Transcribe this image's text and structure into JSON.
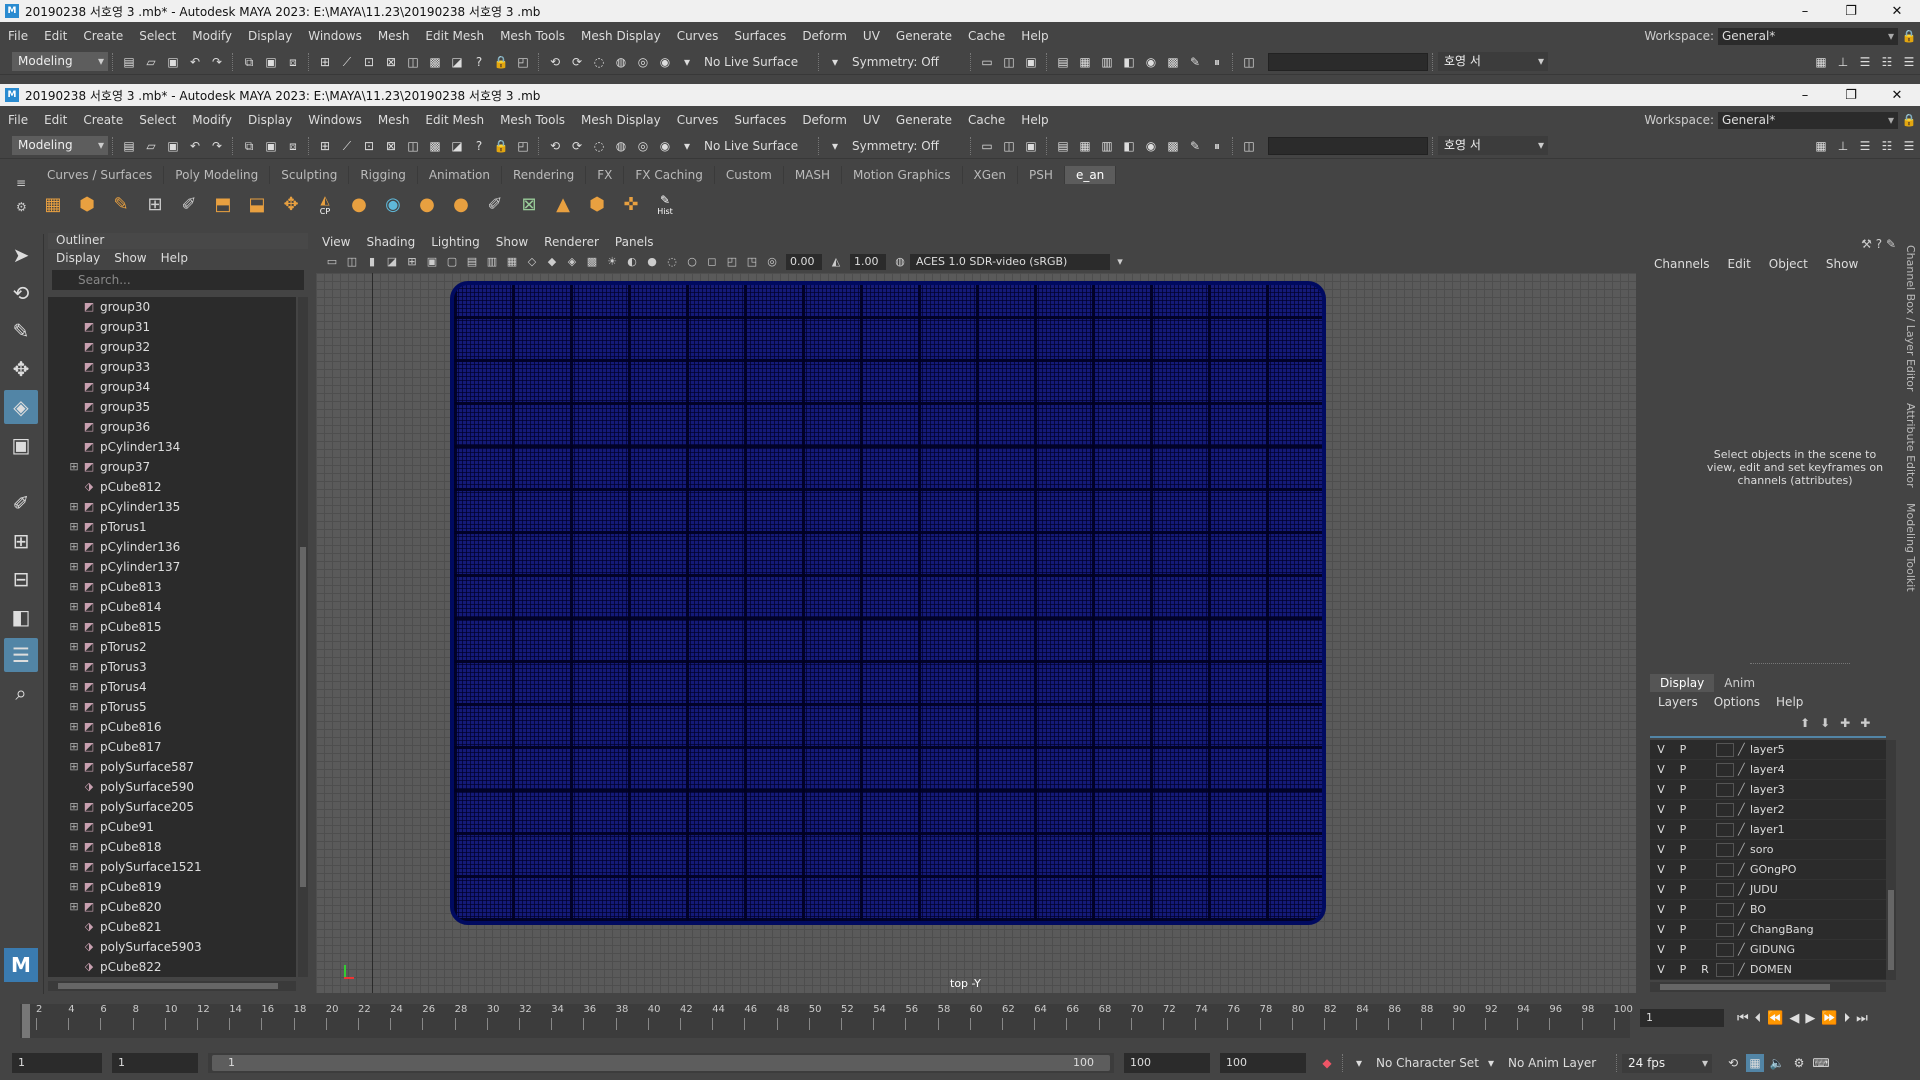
{
  "window": {
    "title_outer": "20190238 서호영 3 .mb* - Autodesk MAYA 2023: E:\\MAYA\\11.23\\20190238 서호영 3 .mb",
    "title_inner": "20190238 서호영 3 .mb* - Autodesk MAYA 2023: E:\\MAYA\\11.23\\20190238 서호영 3 .mb",
    "minimize": "–",
    "restore": "❐",
    "close": "✕"
  },
  "menus": [
    "File",
    "Edit",
    "Create",
    "Select",
    "Modify",
    "Display",
    "Windows",
    "Mesh",
    "Edit Mesh",
    "Mesh Tools",
    "Mesh Display",
    "Curves",
    "Surfaces",
    "Deform",
    "UV",
    "Generate",
    "Cache",
    "Help"
  ],
  "workspace": {
    "label": "Workspace:",
    "value": "General*"
  },
  "status": {
    "mode": "Modeling",
    "live_surface": "No Live Surface",
    "symmetry": "Symmetry: Off",
    "user": "호영 서"
  },
  "shelf_tabs": [
    "Curves / Surfaces",
    "Poly Modeling",
    "Sculpting",
    "Rigging",
    "Animation",
    "Rendering",
    "FX",
    "FX Caching",
    "Custom",
    "MASH",
    "Motion Graphics",
    "XGen",
    "PSH",
    "e_an"
  ],
  "shelf_active": "e_an",
  "shelf_icon_labels": {
    "cp": "CP",
    "hist": "Hist"
  },
  "outliner": {
    "title": "Outliner",
    "menu": [
      "Display",
      "Show",
      "Help"
    ],
    "search_placeholder": "Search...",
    "items": [
      {
        "name": "group30",
        "expand": false,
        "type": "mesh"
      },
      {
        "name": "group31",
        "expand": false,
        "type": "mesh"
      },
      {
        "name": "group32",
        "expand": false,
        "type": "mesh"
      },
      {
        "name": "group33",
        "expand": false,
        "type": "mesh"
      },
      {
        "name": "group34",
        "expand": false,
        "type": "mesh"
      },
      {
        "name": "group35",
        "expand": false,
        "type": "mesh"
      },
      {
        "name": "group36",
        "expand": false,
        "type": "mesh"
      },
      {
        "name": "pCylinder134",
        "expand": false,
        "type": "mesh"
      },
      {
        "name": "group37",
        "expand": true,
        "type": "mesh"
      },
      {
        "name": "pCube812",
        "expand": false,
        "type": "group"
      },
      {
        "name": "pCylinder135",
        "expand": true,
        "type": "mesh"
      },
      {
        "name": "pTorus1",
        "expand": true,
        "type": "mesh"
      },
      {
        "name": "pCylinder136",
        "expand": true,
        "type": "mesh"
      },
      {
        "name": "pCylinder137",
        "expand": true,
        "type": "mesh"
      },
      {
        "name": "pCube813",
        "expand": true,
        "type": "mesh"
      },
      {
        "name": "pCube814",
        "expand": true,
        "type": "mesh"
      },
      {
        "name": "pCube815",
        "expand": true,
        "type": "mesh"
      },
      {
        "name": "pTorus2",
        "expand": true,
        "type": "mesh"
      },
      {
        "name": "pTorus3",
        "expand": true,
        "type": "mesh"
      },
      {
        "name": "pTorus4",
        "expand": true,
        "type": "mesh"
      },
      {
        "name": "pTorus5",
        "expand": true,
        "type": "mesh"
      },
      {
        "name": "pCube816",
        "expand": true,
        "type": "mesh"
      },
      {
        "name": "pCube817",
        "expand": true,
        "type": "mesh"
      },
      {
        "name": "polySurface587",
        "expand": true,
        "type": "mesh"
      },
      {
        "name": "polySurface590",
        "expand": false,
        "type": "group"
      },
      {
        "name": "polySurface205",
        "expand": true,
        "type": "mesh"
      },
      {
        "name": "pCube91",
        "expand": true,
        "type": "mesh"
      },
      {
        "name": "pCube818",
        "expand": true,
        "type": "mesh"
      },
      {
        "name": "polySurface1521",
        "expand": true,
        "type": "mesh"
      },
      {
        "name": "pCube819",
        "expand": true,
        "type": "mesh"
      },
      {
        "name": "pCube820",
        "expand": true,
        "type": "mesh"
      },
      {
        "name": "pCube821",
        "expand": false,
        "type": "group"
      },
      {
        "name": "polySurface5903",
        "expand": false,
        "type": "group"
      },
      {
        "name": "pCube822",
        "expand": false,
        "type": "group"
      }
    ]
  },
  "viewport": {
    "menu": [
      "View",
      "Shading",
      "Lighting",
      "Show",
      "Renderer",
      "Panels"
    ],
    "exposure": "0.00",
    "gamma": "1.00",
    "colorspace": "ACES 1.0 SDR-video (sRGB)",
    "camera": "top -Y"
  },
  "channel_box": {
    "menu": [
      "Channels",
      "Edit",
      "Object",
      "Show"
    ],
    "hint": "Select objects in the scene to view, edit and set keyframes on channels (attributes)"
  },
  "layer_editor": {
    "tabs": [
      "Display",
      "Anim"
    ],
    "active_tab": "Display",
    "menu": [
      "Layers",
      "Options",
      "Help"
    ],
    "layers": [
      {
        "v": "V",
        "p": "P",
        "r": "",
        "name": "layer5"
      },
      {
        "v": "V",
        "p": "P",
        "r": "",
        "name": "layer4"
      },
      {
        "v": "V",
        "p": "P",
        "r": "",
        "name": "layer3"
      },
      {
        "v": "V",
        "p": "P",
        "r": "",
        "name": "layer2"
      },
      {
        "v": "V",
        "p": "P",
        "r": "",
        "name": "layer1"
      },
      {
        "v": "V",
        "p": "P",
        "r": "",
        "name": "soro"
      },
      {
        "v": "V",
        "p": "P",
        "r": "",
        "name": "GOngPO"
      },
      {
        "v": "V",
        "p": "P",
        "r": "",
        "name": "JUDU"
      },
      {
        "v": "V",
        "p": "P",
        "r": "",
        "name": "BO"
      },
      {
        "v": "V",
        "p": "P",
        "r": "",
        "name": "ChangBang"
      },
      {
        "v": "V",
        "p": "P",
        "r": "",
        "name": "GIDUNG"
      },
      {
        "v": "V",
        "p": "P",
        "r": "R",
        "name": "DOMEN"
      }
    ]
  },
  "side_tabs": [
    "Channel Box / Layer Editor",
    "Attribute Editor",
    "Modeling Toolkit"
  ],
  "timeline": {
    "ticks": [
      "2",
      "4",
      "6",
      "8",
      "10",
      "12",
      "14",
      "16",
      "18",
      "20",
      "22",
      "24",
      "26",
      "28",
      "30",
      "32",
      "34",
      "36",
      "38",
      "40",
      "42",
      "44",
      "46",
      "48",
      "50",
      "52",
      "54",
      "56",
      "58",
      "60",
      "62",
      "64",
      "66",
      "68",
      "70",
      "72",
      "74",
      "76",
      "78",
      "80",
      "82",
      "84",
      "86",
      "88",
      "90",
      "92",
      "94",
      "96",
      "98",
      "100"
    ],
    "current_frame": "1"
  },
  "range": {
    "start": "1",
    "anim_start": "1",
    "slider_start": "1",
    "slider_end": "100",
    "anim_end": "100",
    "end": "100",
    "character_set": "No Character Set",
    "anim_layer": "No Anim Layer",
    "fps": "24 fps"
  }
}
